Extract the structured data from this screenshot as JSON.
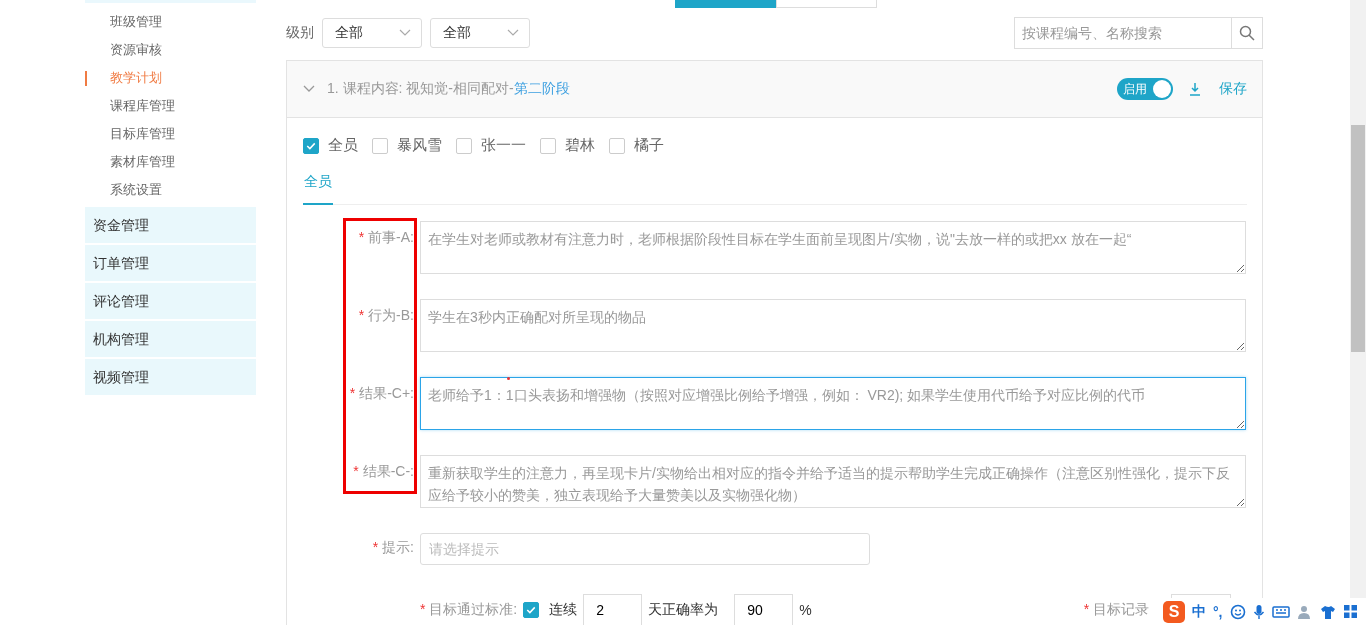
{
  "sidebar": {
    "submenu": [
      {
        "label": "班级管理",
        "selected": false
      },
      {
        "label": "资源审核",
        "selected": false
      },
      {
        "label": "教学计划",
        "selected": true
      },
      {
        "label": "课程库管理",
        "selected": false
      },
      {
        "label": "目标库管理",
        "selected": false
      },
      {
        "label": "素材库管理",
        "selected": false
      },
      {
        "label": "系统设置",
        "selected": false
      }
    ],
    "groups": [
      "资金管理",
      "订单管理",
      "评论管理",
      "机构管理",
      "视频管理"
    ]
  },
  "top_tabs": [
    {
      "selected": true
    },
    {
      "selected": false
    }
  ],
  "filter": {
    "label": "级别",
    "selects": [
      "全部",
      "全部"
    ],
    "search": {
      "placeholder": "按课程编号、名称搜索"
    }
  },
  "plan": {
    "title": "1. 课程内容: 视知觉-相同配对-",
    "title_link": "第二阶段",
    "toggle": {
      "label": "启用",
      "on": true
    },
    "save": "保存",
    "members": [
      {
        "label": "全员",
        "checked": true
      },
      {
        "label": "暴风雪",
        "checked": false
      },
      {
        "label": "张一一",
        "checked": false
      },
      {
        "label": "碧林",
        "checked": false
      },
      {
        "label": "橘子",
        "checked": false
      }
    ],
    "member_tabs": [
      {
        "label": "全员",
        "selected": true
      }
    ],
    "fields": [
      {
        "label": "前事-A:",
        "marker": "*",
        "focused": false,
        "value": "在学生对老师或教材有注意力时，老师根据阶段性目标在学生面前呈现图片/实物，说\"去放一样的或把xx 放在一起“"
      },
      {
        "label": "行为-B:",
        "marker": "*",
        "focused": false,
        "value": "学生在3秒内正确配对所呈现的物品"
      },
      {
        "label": "结果-C+:",
        "marker": "*",
        "focused": true,
        "value": "老师给予1：1口头表扬和增强物（按照对应增强比例给予增强，例如： VR2); 如果学生使用代币给予对应比例的代币"
      },
      {
        "label": "结果-C-:",
        "marker": "*",
        "focused": false,
        "value": "重新获取学生的注意力，再呈现卡片/实物给出相对应的指令并给予适当的提示帮助学生完成正确操作（注意区别性强化，提示下反应给予较小的赞美，独立表现给予大量赞美以及实物强化物）"
      }
    ],
    "hint": {
      "label": "提示:",
      "marker": "*",
      "placeholder": "请选择提示"
    },
    "criteria": {
      "label": "目标通过标准:",
      "marker": "*",
      "checked": true,
      "text_1": "连续",
      "days": "2",
      "text_2": "天正确率为",
      "rate": "90",
      "unit": "%",
      "record_label": "目标记录",
      "record_marker": "*"
    }
  },
  "ime_toolbar": {
    "logo": "S",
    "mode": "中",
    "punct": "°,"
  }
}
